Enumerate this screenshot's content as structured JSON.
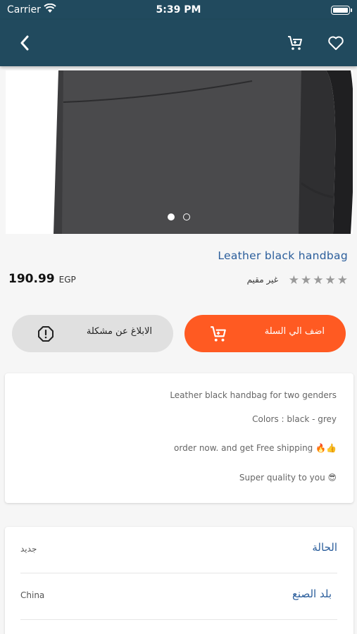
{
  "status_bar": {
    "carrier": "Carrier",
    "time": "5:39 PM"
  },
  "nav": {
    "back_icon": "chevron-left-icon",
    "cart_icon": "cart-icon",
    "favorite_icon": "heart-icon"
  },
  "gallery": {
    "image": "product-bag-image",
    "page_count": 2,
    "current_page": 1
  },
  "product": {
    "title": "Leather black handbag",
    "price": "190.99",
    "currency": "EGP",
    "rating_text": "غير مقيم",
    "rating_value": 0,
    "rating_max": 5
  },
  "actions": {
    "report": {
      "label": "الابلاغ عن مشكلة",
      "icon": "alert-circle-icon"
    },
    "add_to_cart": {
      "label": "اضف الي السلة",
      "icon": "cart-icon"
    }
  },
  "description": [
    "Leather black handbag for two genders",
    "Colors : black - grey",
    "order now. and get Free shipping 🔥👍",
    "Super quality to you 😎"
  ],
  "specs": [
    {
      "label": "الحالة",
      "value": "جديد"
    },
    {
      "label": "بلد الصنع",
      "value": "China"
    }
  ],
  "colors": {
    "header": "#214a5e",
    "accent": "#ff5a22",
    "link": "#2a5d9b",
    "star_empty": "#9a9a9a"
  }
}
